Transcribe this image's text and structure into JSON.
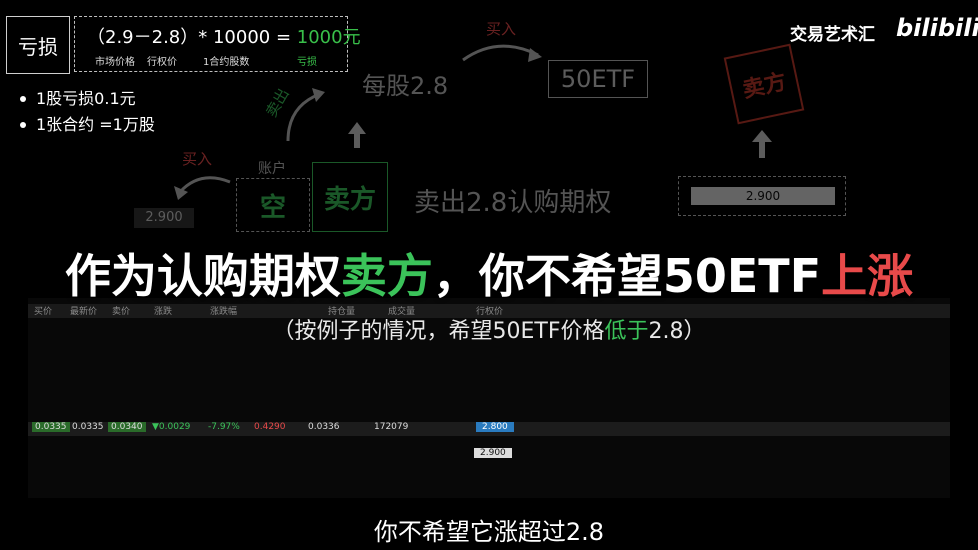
{
  "watermark": {
    "channel": "交易艺术汇",
    "brand": "bilibili"
  },
  "loss_box": {
    "label": "亏损"
  },
  "formula": {
    "expr_a": "（2.9－2.8）* 10000 = ",
    "expr_b": "1000元",
    "sub1": "市场价格",
    "sub2": "行权价",
    "sub3": "1合约股数",
    "sub4": "亏损"
  },
  "bullets": [
    "1股亏损0.1元",
    "1张合约 =1万股"
  ],
  "diagram": {
    "buy_in_top": "买入",
    "per_share": "每股2.8",
    "etf": "50ETF",
    "seller_stamp": "卖方",
    "sell_out": "卖出",
    "buy_in_left": "买入",
    "price_left": "2.900",
    "account": "账户",
    "empty": "空",
    "seller_green": "卖方",
    "sell_call": "卖出2.8认购期权",
    "price_right": "2.900"
  },
  "subtitle": {
    "part1": "作为认购期权",
    "part2": "卖方",
    "part3": "，你不希望50ETF",
    "part4": "上涨"
  },
  "note": {
    "part1": "（按例子的情况，希望50ETF价格",
    "part2": "低于",
    "part3": "2.8）"
  },
  "table": {
    "headers": [
      "买价",
      "最新价",
      "卖价",
      "涨跌",
      "涨跌幅",
      "持仓量",
      "成交量",
      "行权价"
    ],
    "rows": [
      [
        "0.0335",
        "0.0335",
        "0.0340",
        "▼0.0029",
        "-7.97%",
        "0.4290",
        "0.0336",
        "172079",
        "2.800"
      ],
      [
        "",
        "",
        "",
        "",
        "",
        "",
        "",
        "",
        "2.900"
      ]
    ]
  },
  "caption": "你不希望它涨超过2.8",
  "colors": {
    "green": "#3bc35a",
    "red": "#e84a4a",
    "stamp_red": "#c0392b"
  }
}
